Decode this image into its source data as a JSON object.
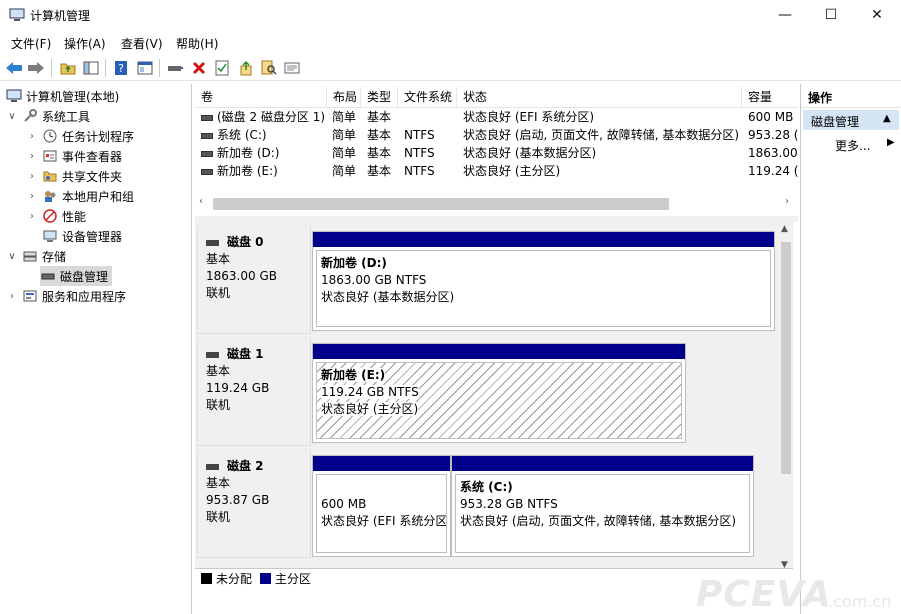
{
  "window": {
    "title": "计算机管理",
    "minimize": "—",
    "maximize": "☐",
    "close": "✕"
  },
  "menu": [
    "文件(F)",
    "操作(A)",
    "查看(V)",
    "帮助(H)"
  ],
  "toolbar_icons": [
    "back-arrow-icon",
    "forward-arrow-icon",
    "up-folder-icon",
    "show-hide-tree-icon",
    "help-icon",
    "properties-icon",
    "connect-disk-icon",
    "delete-icon",
    "checklist-icon",
    "export-icon",
    "search-icon",
    "view-icon"
  ],
  "tree": {
    "root": "计算机管理(本地)",
    "system_tools": "系统工具",
    "task_scheduler": "任务计划程序",
    "event_viewer": "事件查看器",
    "shared_folders": "共享文件夹",
    "local_users": "本地用户和组",
    "performance": "性能",
    "device_manager": "设备管理器",
    "storage": "存储",
    "disk_management": "磁盘管理",
    "services_apps": "服务和应用程序"
  },
  "volumes": {
    "columns": [
      "卷",
      "布局",
      "类型",
      "文件系统",
      "状态",
      "容量"
    ],
    "rows": [
      {
        "name": "(磁盘 2 磁盘分区 1)",
        "layout": "简单",
        "type": "基本",
        "fs": "",
        "status": "状态良好 (EFI 系统分区)",
        "capacity": "600 MB"
      },
      {
        "name": "系统 (C:)",
        "layout": "简单",
        "type": "基本",
        "fs": "NTFS",
        "status": "状态良好 (启动, 页面文件, 故障转储, 基本数据分区)",
        "capacity": "953.28 ("
      },
      {
        "name": "新加卷 (D:)",
        "layout": "简单",
        "type": "基本",
        "fs": "NTFS",
        "status": "状态良好 (基本数据分区)",
        "capacity": "1863.00"
      },
      {
        "name": "新加卷 (E:)",
        "layout": "简单",
        "type": "基本",
        "fs": "NTFS",
        "status": "状态良好 (主分区)",
        "capacity": "119.24 ("
      }
    ]
  },
  "disks": [
    {
      "name": "磁盘 0",
      "type": "基本",
      "size": "1863.00 GB",
      "state": "联机",
      "partitions": [
        {
          "title": "新加卷   (D:)",
          "size": "1863.00 GB NTFS",
          "status": "状态良好 (基本数据分区)"
        }
      ]
    },
    {
      "name": "磁盘 1",
      "type": "基本",
      "size": "119.24 GB",
      "state": "联机",
      "partitions": [
        {
          "title": "新加卷   (E:)",
          "size": "119.24 GB NTFS",
          "status": "状态良好 (主分区)"
        }
      ]
    },
    {
      "name": "磁盘 2",
      "type": "基本",
      "size": "953.87 GB",
      "state": "联机",
      "partitions": [
        {
          "title": "",
          "size": "600 MB",
          "status": "状态良好 (EFI 系统分区"
        },
        {
          "title": "系统   (C:)",
          "size": "953.28 GB NTFS",
          "status": "状态良好 (启动, 页面文件, 故障转储, 基本数据分区)"
        }
      ]
    }
  ],
  "legend": {
    "unallocated": "未分配",
    "primary": "主分区"
  },
  "colors": {
    "primary_partition": "#00008b",
    "unallocated": "#000000",
    "selection": "#d5e5f5"
  },
  "actions": {
    "title": "操作",
    "disk_management": "磁盘管理",
    "more": "更多..."
  },
  "watermark": {
    "main": "PCEVA",
    "sub": ".com.cn"
  }
}
